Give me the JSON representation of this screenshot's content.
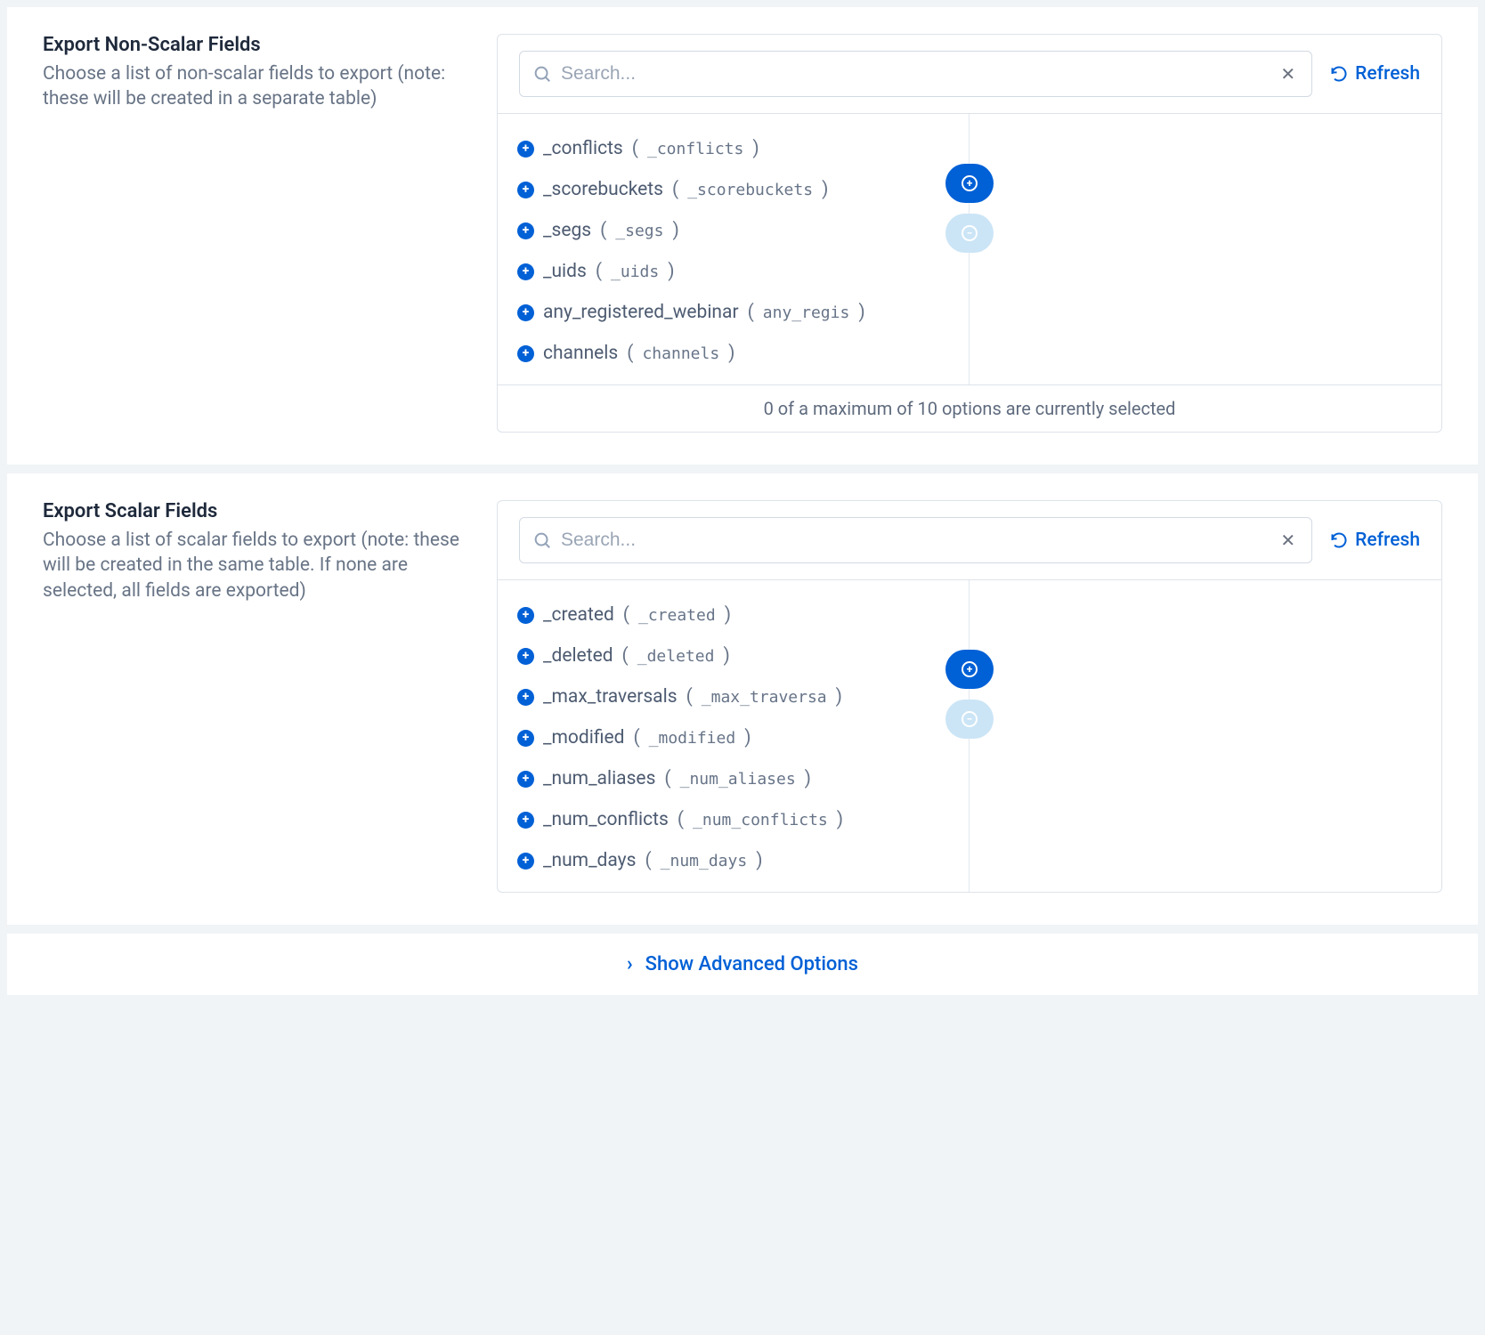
{
  "sections": {
    "nonscalar": {
      "title": "Export Non-Scalar Fields",
      "description": "Choose a list of non-scalar fields to export (note: these will be created in a separate table)",
      "search_placeholder": "Search...",
      "refresh_label": "Refresh",
      "footer": "0 of a maximum of 10 options are currently selected",
      "items": [
        {
          "label": "_conflicts",
          "code": "_conflicts"
        },
        {
          "label": "_scorebuckets",
          "code": "_scorebuckets"
        },
        {
          "label": "_segs",
          "code": "_segs"
        },
        {
          "label": "_uids",
          "code": "_uids"
        },
        {
          "label": "any_registered_webinar",
          "code": "any_regis"
        },
        {
          "label": "channels",
          "code": "channels"
        }
      ]
    },
    "scalar": {
      "title": "Export Scalar Fields",
      "description": "Choose a list of scalar fields to export (note: these will be created in the same table. If none are selected, all fields are exported)",
      "search_placeholder": "Search...",
      "refresh_label": "Refresh",
      "items": [
        {
          "label": "_created",
          "code": "_created"
        },
        {
          "label": "_deleted",
          "code": "_deleted"
        },
        {
          "label": "_max_traversals",
          "code": "_max_traversa"
        },
        {
          "label": "_modified",
          "code": "_modified"
        },
        {
          "label": "_num_aliases",
          "code": "_num_aliases"
        },
        {
          "label": "_num_conflicts",
          "code": "_num_conflicts"
        },
        {
          "label": "_num_days",
          "code": "_num_days"
        }
      ]
    }
  },
  "advanced_label": "Show Advanced Options"
}
